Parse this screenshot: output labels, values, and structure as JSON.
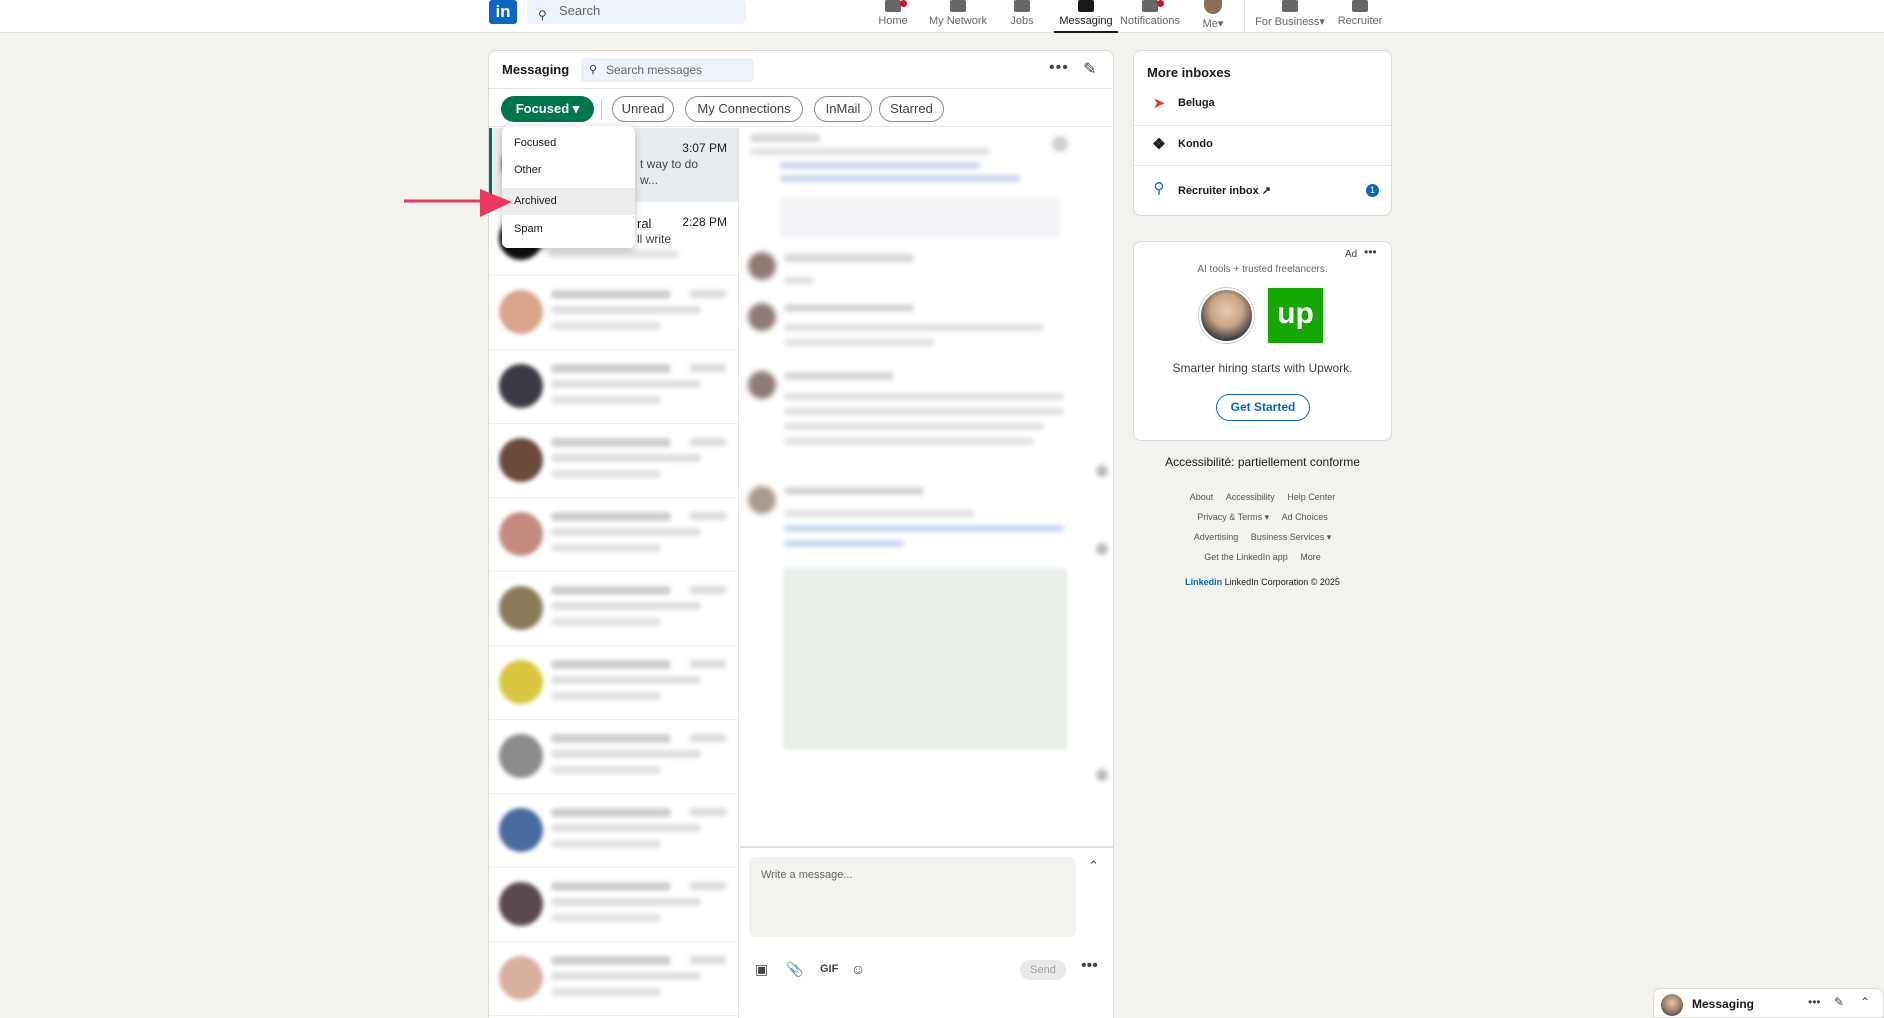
{
  "nav": {
    "logo": "in",
    "search_placeholder": "Search",
    "items": [
      {
        "label": "Home",
        "icon": "home-icon"
      },
      {
        "label": "My Network",
        "icon": "network-icon"
      },
      {
        "label": "Jobs",
        "icon": "jobs-icon"
      },
      {
        "label": "Messaging",
        "icon": "messaging-icon"
      },
      {
        "label": "Notifications",
        "icon": "bell-icon"
      },
      {
        "label": "Me",
        "icon": "avatar"
      },
      {
        "label": "For Business",
        "icon": "grid-icon"
      },
      {
        "label": "Recruiter",
        "icon": "recruiter-icon"
      }
    ]
  },
  "messaging": {
    "title": "Messaging",
    "search_placeholder": "Search messages",
    "filters": [
      "Focused",
      "Unread",
      "My Connections",
      "InMail",
      "Starred"
    ],
    "dropdown": [
      "Focused",
      "Other",
      "Archived",
      "Spam"
    ],
    "visible_conv": [
      {
        "time": "3:07 PM",
        "snippet1": "t way to do",
        "snippet2": "w..."
      },
      {
        "time": "2:28 PM",
        "snippet1": "ral",
        "snippet2": "ll write"
      }
    ],
    "composer_placeholder": "Write a message...",
    "gif_label": "GIF",
    "send_label": "Send"
  },
  "inboxes": {
    "title": "More inboxes",
    "items": [
      {
        "label": "Beluga",
        "icon": "beluga-icon"
      },
      {
        "label": "Kondo",
        "icon": "kondo-icon"
      },
      {
        "label": "Recruiter inbox",
        "icon": "recruiter-icon",
        "badge": "1"
      }
    ]
  },
  "ad": {
    "label": "Ad",
    "tagline": "AI tools + trusted freelancers.",
    "logo_text": "up",
    "text": "Smarter hiring starts with Upwork.",
    "cta": "Get Started"
  },
  "footer": {
    "a11y": "Accessibilité: partiellement conforme",
    "row1": [
      "About",
      "Accessibility",
      "Help Center"
    ],
    "row2": [
      "Privacy & Terms ▾",
      "Ad Choices"
    ],
    "row3": [
      "Advertising",
      "Business Services ▾"
    ],
    "row4": [
      "Get the LinkedIn app",
      "More"
    ],
    "brand_logo": "Linkedin",
    "brand_text": "LinkedIn Corporation © 2025"
  },
  "msg_bar": {
    "label": "Messaging"
  },
  "colors": {
    "accent": "#01754f",
    "brand": "#0a66c2",
    "arrow": "#e8385f"
  }
}
